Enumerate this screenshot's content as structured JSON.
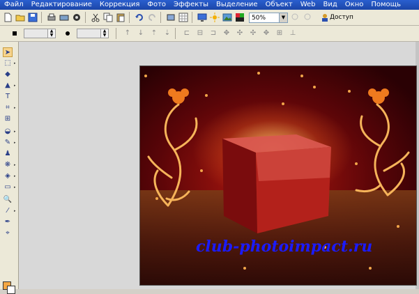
{
  "menu": {
    "items": [
      "Файл",
      "Редактирование",
      "Коррекция",
      "Фото",
      "Эффекты",
      "Выделение",
      "Объект",
      "Web",
      "Вид",
      "Окно",
      "Помощь"
    ]
  },
  "toolbar": {
    "zoom_value": "50%",
    "access_label": "Доступ"
  },
  "canvas": {
    "watermark": "club-photoimpact.ru"
  },
  "colors": {
    "menubar": "#1c46a8",
    "foreground": "#f4a742",
    "background": "#ffffff",
    "watermark": "#1b1bff"
  }
}
